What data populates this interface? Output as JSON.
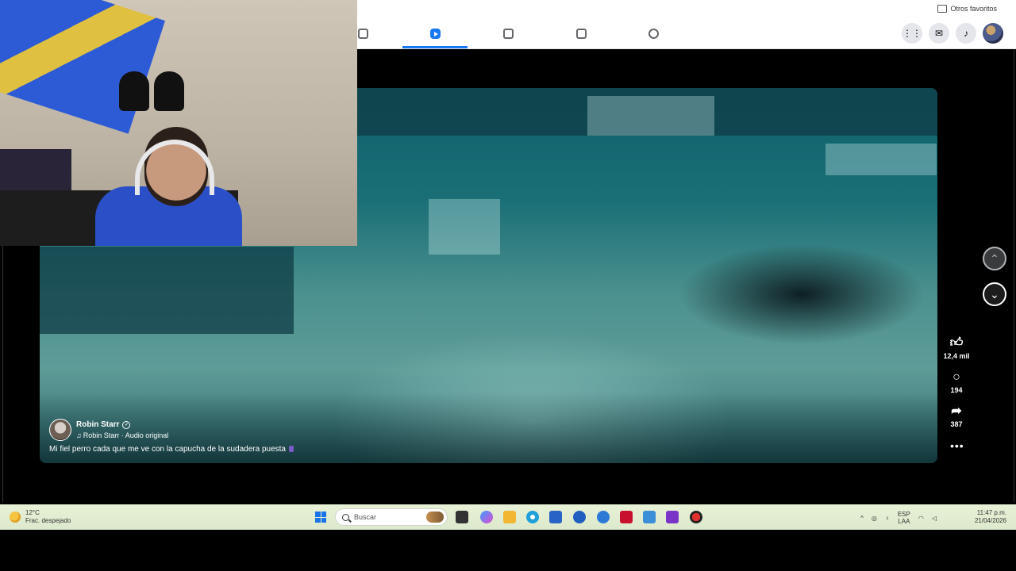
{
  "browser": {
    "other_favorites": "Otros favoritos"
  },
  "fb_nav": {
    "tabs": [
      "home-icon",
      "reels-icon",
      "feeds-icon",
      "marketplace-icon",
      "groups-icon"
    ],
    "active_tab": "reels-icon",
    "right_icons": [
      "menu-grid-icon",
      "messenger-icon",
      "notifications-icon",
      "profile-avatar"
    ]
  },
  "reel": {
    "author_name": "Robin Starr",
    "audio": "Robin Starr · Audio original",
    "caption": "Mi fiel perro cada que me ve con la capucha de la sudadera puesta",
    "likes": "12,4 mil",
    "comments": "194",
    "shares": "387"
  },
  "taskbar": {
    "temperature": "12°C",
    "weather_desc": "Frac. despejado",
    "search_placeholder": "Buscar",
    "lang_line1": "ESP",
    "lang_line2": "LAA",
    "time": "11:47 p.m.",
    "date": "21/04/2026"
  },
  "colors": {
    "fb_blue": "#1877f2",
    "taskbar_bg": "#e7f1d6",
    "video_teal": "#1a6f76"
  }
}
